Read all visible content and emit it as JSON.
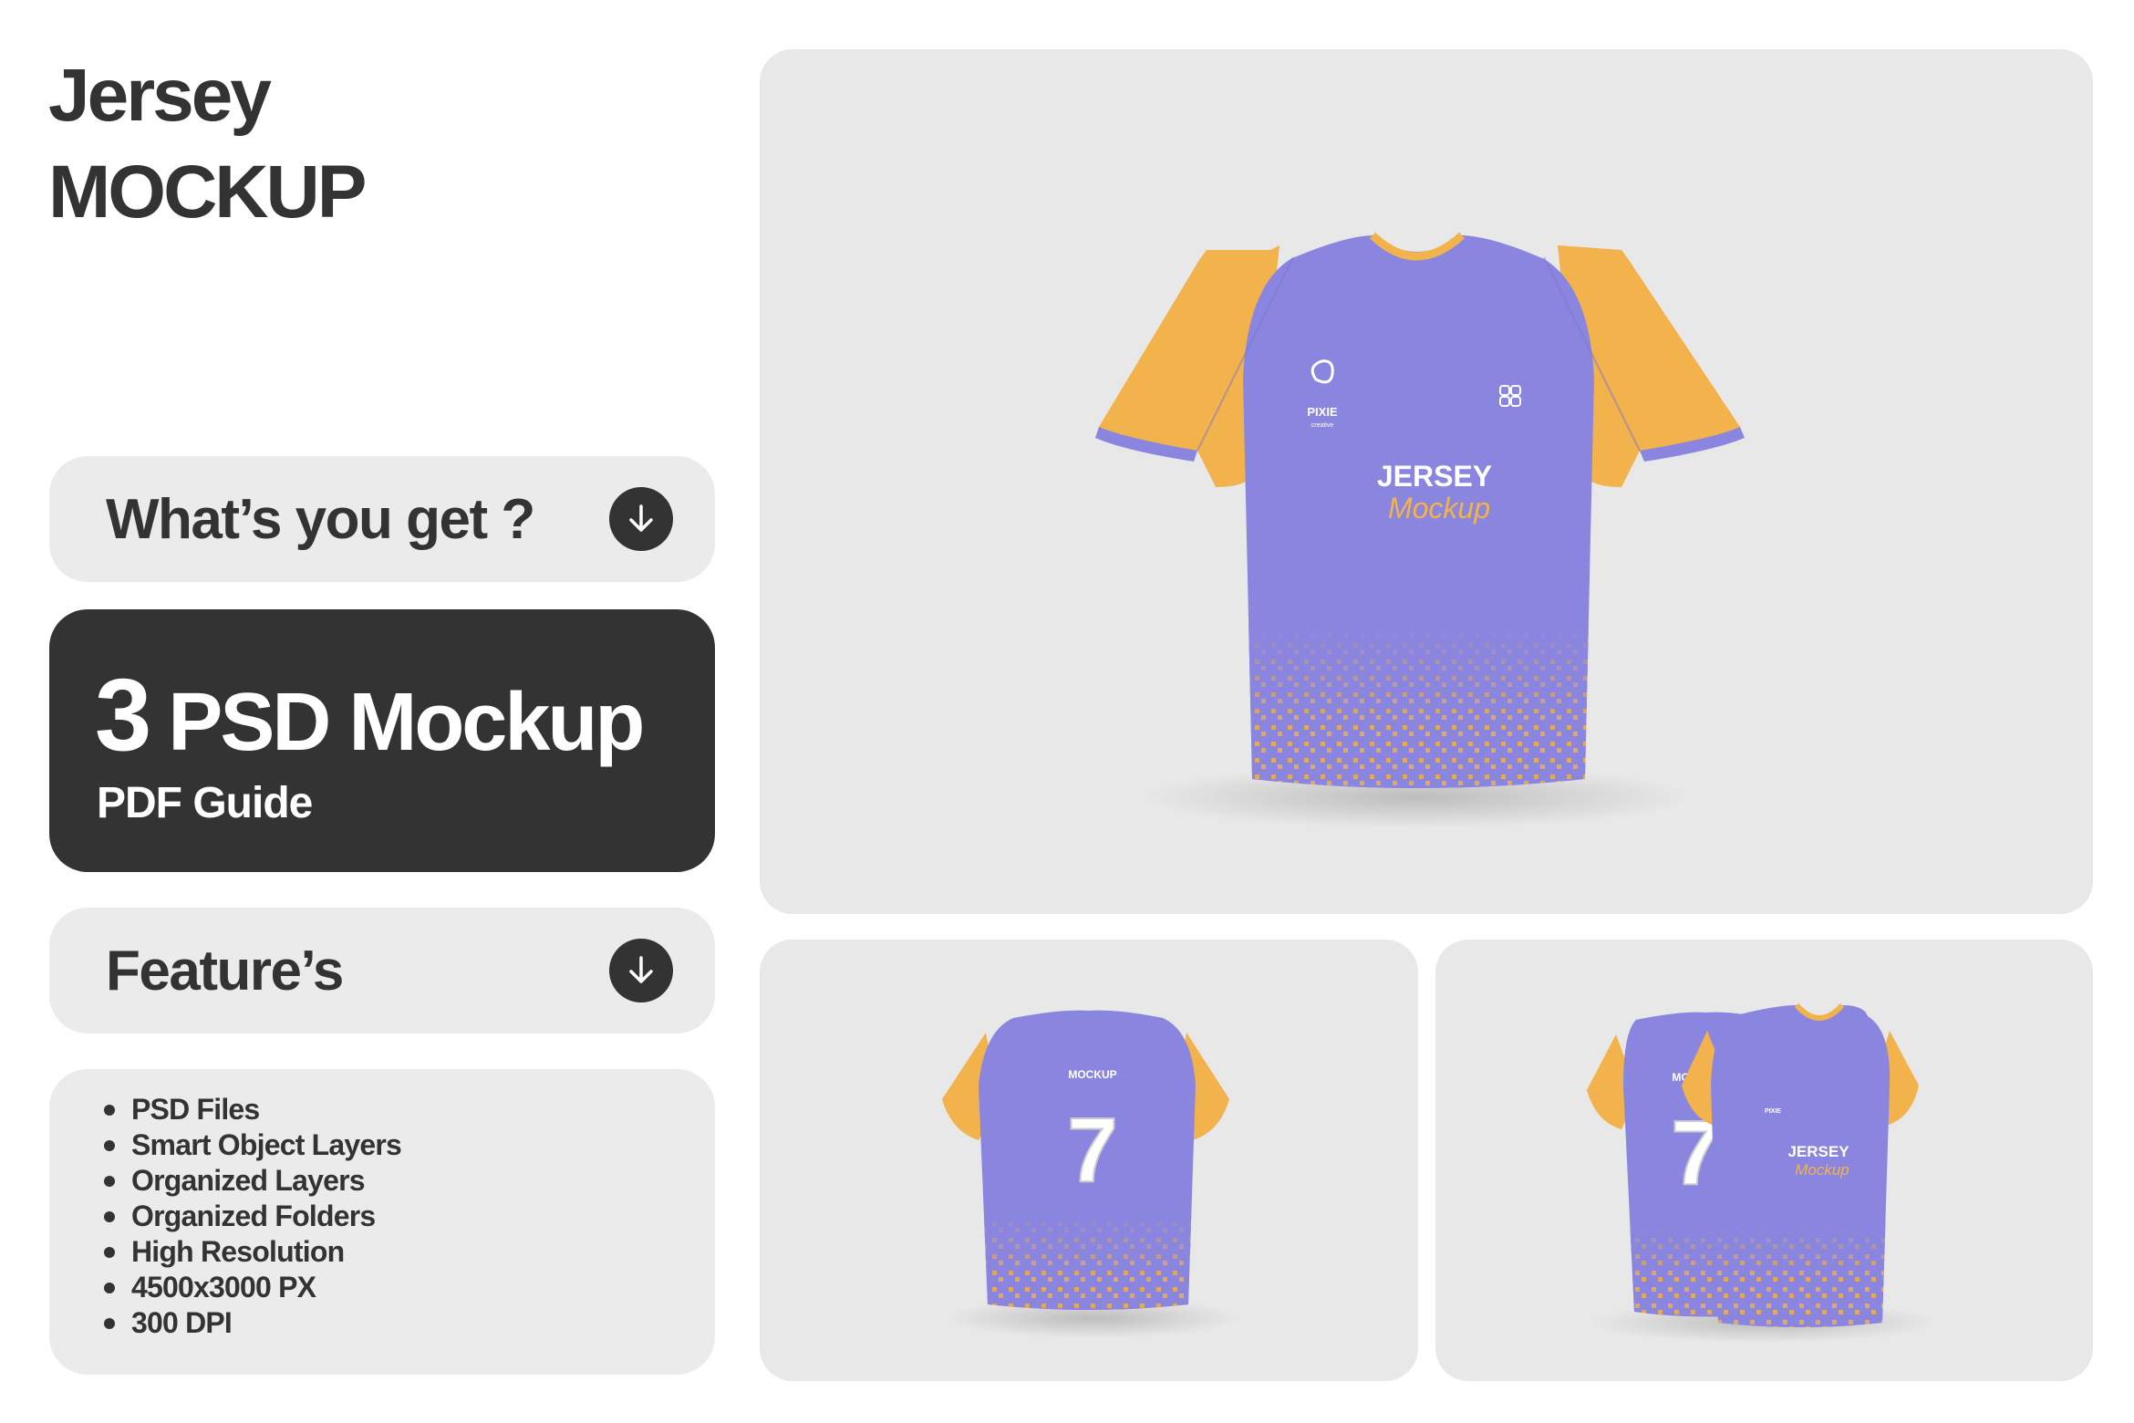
{
  "header": {
    "title_line1": "Jersey",
    "title_line2": "MOCKUP"
  },
  "whats_you_get": {
    "label": "What’s you get ?",
    "icon": "arrow-down-circle-icon"
  },
  "offer": {
    "count": "3",
    "title": "PSD Mockup",
    "subtitle": "PDF Guide"
  },
  "features_header": {
    "label": "Feature’s",
    "icon": "arrow-down-circle-icon"
  },
  "features": [
    "PSD Files",
    "Smart Object Layers",
    "Organized Layers",
    "Organized Folders",
    "High Resolution",
    "4500x3000 PX",
    "300 DPI"
  ],
  "jersey_print": {
    "front_title": "JERSEY",
    "front_script": "Mockup",
    "brand": "PIXIE",
    "brand_sub": "creative",
    "back_label": "MOCKUP",
    "back_number": "7"
  },
  "colors": {
    "dark": "#333333",
    "panel": "#ebebeb",
    "card": "#e8e8e8",
    "jersey_body": "#8a86e0",
    "jersey_sleeve": "#f2b24c"
  }
}
